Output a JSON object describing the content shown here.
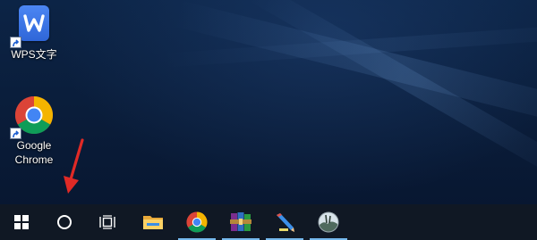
{
  "desktop": {
    "icons": [
      {
        "label": "WPS文字",
        "icon": "wps-writer-icon"
      },
      {
        "label": "Google\nChrome",
        "icon": "chrome-icon"
      }
    ]
  },
  "taskbar": {
    "buttons": [
      {
        "name": "start",
        "icon": "windows-logo-icon"
      },
      {
        "name": "search",
        "icon": "cortana-circle-icon"
      },
      {
        "name": "task-view",
        "icon": "task-view-icon"
      },
      {
        "name": "file-explorer",
        "icon": "folder-icon"
      },
      {
        "name": "chrome",
        "icon": "chrome-icon",
        "running": true
      },
      {
        "name": "winrar",
        "icon": "winrar-books-icon",
        "running": true
      },
      {
        "name": "paint",
        "icon": "pencil-icon",
        "running": true
      },
      {
        "name": "photo-app",
        "icon": "landscape-circle-icon",
        "running": true
      }
    ],
    "colors": {
      "background": "#101824",
      "running_indicator": "#76b9ed"
    }
  },
  "annotation": {
    "type": "red-arrow",
    "color": "#e02a26",
    "points_to": "search"
  },
  "colors": {
    "desktop_dark": "#0a1d3a",
    "wps_blue": "#3a74e6"
  }
}
